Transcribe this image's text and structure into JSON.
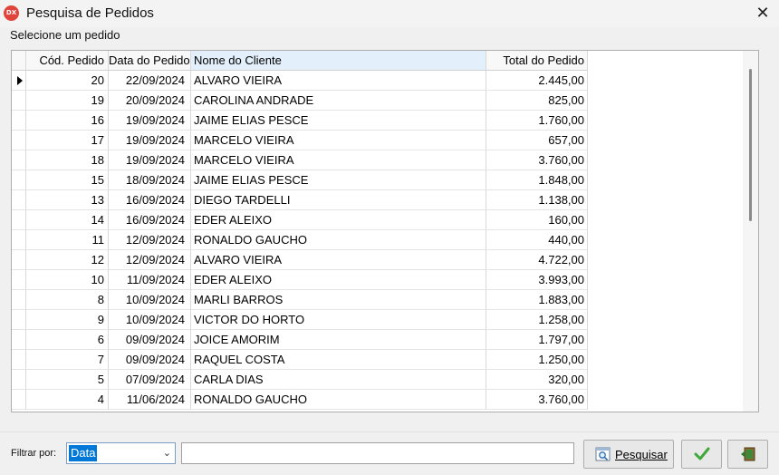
{
  "window": {
    "icon_text": "DX",
    "title": "Pesquisa de Pedidos",
    "close_glyph": "✕"
  },
  "caption": "Selecione um pedido",
  "grid": {
    "columns": [
      "Cód. Pedido",
      "Data do Pedido",
      "Nome do Cliente",
      "Total do Pedido"
    ],
    "selected_row": 0,
    "rows": [
      {
        "cod": "20",
        "data": "22/09/2024",
        "nome": "ALVARO VIEIRA",
        "total": "2.445,00"
      },
      {
        "cod": "19",
        "data": "20/09/2024",
        "nome": "CAROLINA ANDRADE",
        "total": "825,00"
      },
      {
        "cod": "16",
        "data": "19/09/2024",
        "nome": "JAIME ELIAS PESCE",
        "total": "1.760,00"
      },
      {
        "cod": "17",
        "data": "19/09/2024",
        "nome": "MARCELO VIEIRA",
        "total": "657,00"
      },
      {
        "cod": "18",
        "data": "19/09/2024",
        "nome": "MARCELO VIEIRA",
        "total": "3.760,00"
      },
      {
        "cod": "15",
        "data": "18/09/2024",
        "nome": "JAIME ELIAS PESCE",
        "total": "1.848,00"
      },
      {
        "cod": "13",
        "data": "16/09/2024",
        "nome": "DIEGO TARDELLI",
        "total": "1.138,00"
      },
      {
        "cod": "14",
        "data": "16/09/2024",
        "nome": "EDER ALEIXO",
        "total": "160,00"
      },
      {
        "cod": "11",
        "data": "12/09/2024",
        "nome": "RONALDO GAUCHO",
        "total": "440,00"
      },
      {
        "cod": "12",
        "data": "12/09/2024",
        "nome": "ALVARO VIEIRA",
        "total": "4.722,00"
      },
      {
        "cod": "10",
        "data": "11/09/2024",
        "nome": "EDER ALEIXO",
        "total": "3.993,00"
      },
      {
        "cod": "8",
        "data": "10/09/2024",
        "nome": "MARLI BARROS",
        "total": "1.883,00"
      },
      {
        "cod": "9",
        "data": "10/09/2024",
        "nome": "VICTOR DO HORTO",
        "total": "1.258,00"
      },
      {
        "cod": "6",
        "data": "09/09/2024",
        "nome": "JOICE AMORIM",
        "total": "1.797,00"
      },
      {
        "cod": "7",
        "data": "09/09/2024",
        "nome": "RAQUEL COSTA",
        "total": "1.250,00"
      },
      {
        "cod": "5",
        "data": "07/09/2024",
        "nome": "CARLA DIAS",
        "total": "320,00"
      },
      {
        "cod": "4",
        "data": "11/06/2024",
        "nome": "RONALDO GAUCHO",
        "total": "3.760,00"
      }
    ]
  },
  "filter": {
    "label": "Filtrar por:",
    "selected": "Data",
    "search_value": ""
  },
  "buttons": {
    "search_label": "Pesquisar",
    "ok_icon": "checkmark-icon",
    "exit_icon": "exit-door-icon",
    "search_icon": "magnifier-icon"
  },
  "colors": {
    "accent": "#0078d7",
    "app_icon_bg": "#e0443a",
    "ok_green": "#3fa83a"
  }
}
